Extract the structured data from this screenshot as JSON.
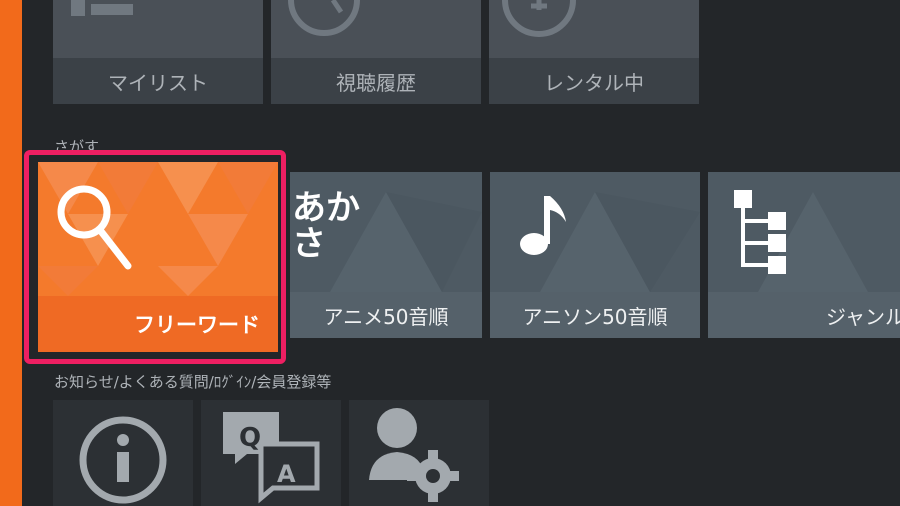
{
  "top_row": [
    {
      "label": "マイリスト",
      "icon": "list-icon"
    },
    {
      "label": "視聴履歴",
      "icon": "history-icon"
    },
    {
      "label": "レンタル中",
      "icon": "rental-icon"
    }
  ],
  "browse_section": {
    "title": "さがす",
    "tiles": [
      {
        "label": "フリーワード",
        "icon": "search-icon"
      },
      {
        "label": "アニメ50音順",
        "icon": "kana-icon",
        "icon_text": "あかさ"
      },
      {
        "label": "アニソン50音順",
        "icon": "music-note-icon"
      },
      {
        "label": "ジャンル",
        "icon": "tree-icon"
      }
    ]
  },
  "info_section": {
    "title": "お知らせ/よくある質問/ﾛｸﾞｲﾝ/会員登録等",
    "tiles": [
      {
        "icon": "info-icon"
      },
      {
        "icon": "qa-icon",
        "q": "Q",
        "a": "A"
      },
      {
        "icon": "user-settings-icon"
      }
    ]
  },
  "colors": {
    "accent": "#f26a1b",
    "focus": "#ee1f62",
    "background": "#232629"
  }
}
